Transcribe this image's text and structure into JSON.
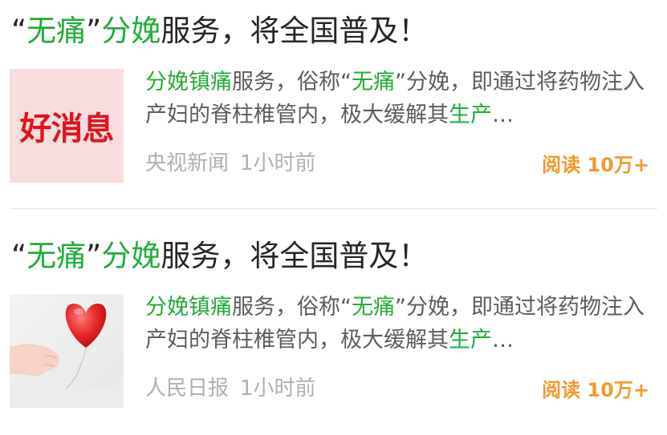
{
  "articles": [
    {
      "title": {
        "q1": "“",
        "hl1": "无痛",
        "q2": "”",
        "hl2": "分娩",
        "rest": "服务，将全国普及！"
      },
      "thumb_text": "好消息",
      "summary": {
        "hl1": "分娩镇痛",
        "t1": "服务，俗称“",
        "hl2": "无痛",
        "t2": "”分娩，即通过将药物注入产妇的脊柱椎管内，极大缓解其",
        "hl3": "生产",
        "ellipsis": "…"
      },
      "source": "央视新闻",
      "time": "1小时前",
      "reads": "阅读 10万+"
    },
    {
      "title": {
        "q1": "“",
        "hl1": "无痛",
        "q2": "”",
        "hl2": "分娩",
        "rest": "服务，将全国普及！"
      },
      "thumb_icon": "heart-balloon-baby-hand",
      "summary": {
        "hl1": "分娩镇痛",
        "t1": "服务，俗称“",
        "hl2": "无痛",
        "t2": "”分娩，即通过将药物注入产妇的脊柱椎管内，极大缓解其",
        "hl3": "生产",
        "ellipsis": "…"
      },
      "source": "人民日报",
      "time": "1小时前",
      "reads": "阅读 10万+"
    }
  ],
  "colors": {
    "highlight": "#22ad38",
    "reads": "#f2992e",
    "thumb_red": "#e0151b"
  }
}
